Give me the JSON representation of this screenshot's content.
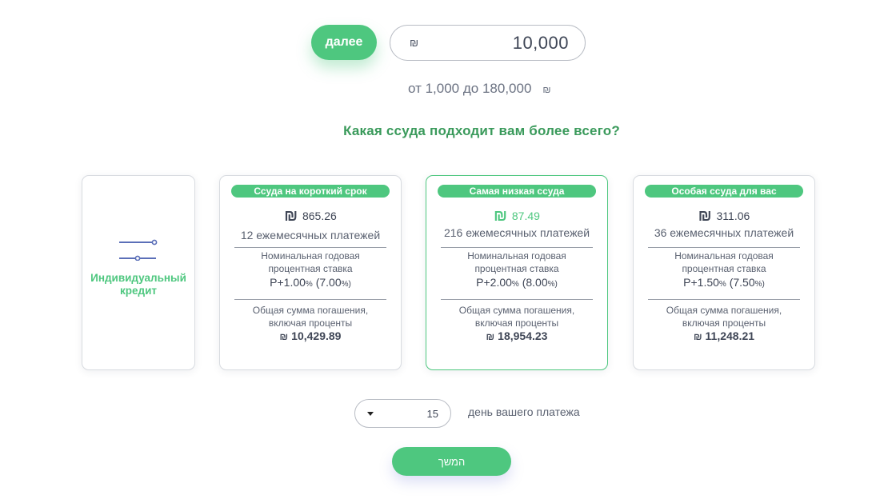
{
  "amount": {
    "next_label": "далее",
    "currency": "₪",
    "value": "10,000",
    "range_text": "от 1,000 до 180,000",
    "range_currency": "₪"
  },
  "question": "Какая ссуда подходит вам более всего?",
  "custom_card": {
    "label_line1": "Индивидуальный",
    "label_line2": "кредит"
  },
  "loans": [
    {
      "badge": "Ссуда на короткий срок",
      "currency": "₪",
      "monthly": "865.26",
      "payments": "12 ежемесячных платежей",
      "rate_label_1": "Номинальная годовая",
      "rate_label_2": "процентная ставка",
      "rate_prime": "P+1.00",
      "rate_pct": "%",
      "rate_total": "(7.00",
      "rate_total_pct": "%)",
      "total_label_1": "Общая сумма погашения,",
      "total_label_2": "включая проценты",
      "total_currency": "₪",
      "total": "10,429.89",
      "selected": false
    },
    {
      "badge": "Самая низкая ссуда",
      "currency": "₪",
      "monthly": "87.49",
      "payments": "216 ежемесячных платежей",
      "rate_label_1": "Номинальная годовая",
      "rate_label_2": "процентная ставка",
      "rate_prime": "P+2.00",
      "rate_pct": "%",
      "rate_total": "(8.00",
      "rate_total_pct": "%)",
      "total_label_1": "Общая сумма погашения,",
      "total_label_2": "включая проценты",
      "total_currency": "₪",
      "total": "18,954.23",
      "selected": true
    },
    {
      "badge": "Особая ссуда для вас",
      "currency": "₪",
      "monthly": "311.06",
      "payments": "36 ежемесячных платежей",
      "rate_label_1": "Номинальная годовая",
      "rate_label_2": "процентная ставка",
      "rate_prime": "P+1.50",
      "rate_pct": "%",
      "rate_total": "(7.50",
      "rate_total_pct": "%)",
      "total_label_1": "Общая сумма погашения,",
      "total_label_2": "включая проценты",
      "total_currency": "₪",
      "total": "11,248.21",
      "selected": false
    }
  ],
  "payment_day": {
    "value": "15",
    "label": "день вашего платежа"
  },
  "continue_label": "המשך",
  "colors": {
    "accent": "#4ec77f",
    "heading": "#3a9a5b",
    "slider_icon": "#5b6fb8"
  }
}
